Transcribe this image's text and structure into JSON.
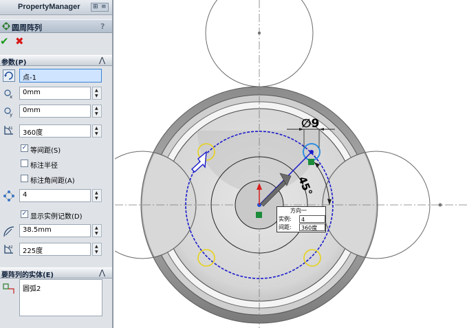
{
  "panel": {
    "title": "PropertyManager",
    "feature_name": "圆周阵列",
    "help": "?",
    "ok": "✔",
    "cancel": "✖"
  },
  "parameters": {
    "section_label": "参数(P)",
    "collapse": "⋀",
    "center_point": "点-1",
    "x_value": "0mm",
    "y_value": "0mm",
    "total_angle": "360度",
    "equal_spacing": {
      "label": "等间距(S)",
      "checked": true
    },
    "dimension_radius": {
      "label": "标注半径",
      "checked": false
    },
    "dimension_angular": {
      "label": "标注角间距(A)",
      "checked": false
    },
    "instance_count": "4",
    "show_instance_count": {
      "label": "显示实例记数(D)",
      "checked": true
    },
    "radius": "38.5mm",
    "angle2": "225度"
  },
  "entities": {
    "section_label": "要阵列的实体(E)",
    "collapse": "⋀",
    "items": [
      "圆弧2"
    ]
  },
  "graphics": {
    "diameter_label": "∅9",
    "angle_label": "45°",
    "tooltip": {
      "title": "方向一",
      "instances_label": "实例:",
      "instances_value": "4",
      "spacing_label": "间距:",
      "spacing_value": "360度"
    }
  },
  "colors": {
    "pattern_circle": "#1a1acc",
    "highlight": "#e6d21a",
    "selected": "#2f8ee0"
  }
}
